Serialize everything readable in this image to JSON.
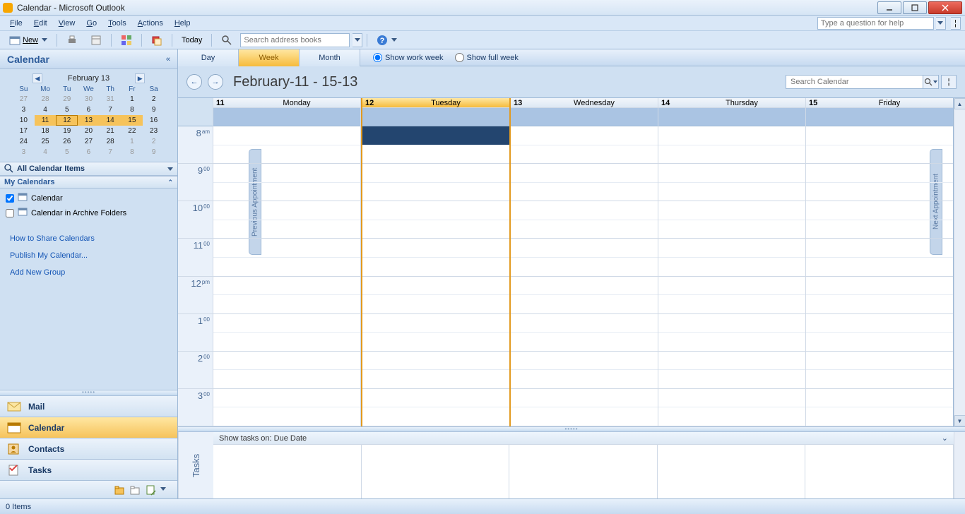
{
  "window": {
    "title": "Calendar - Microsoft Outlook"
  },
  "menu": {
    "items": [
      "File",
      "Edit",
      "View",
      "Go",
      "Tools",
      "Actions",
      "Help"
    ],
    "help_placeholder": "Type a question for help"
  },
  "toolbar": {
    "new_label": "New",
    "today_label": "Today",
    "address_placeholder": "Search address books"
  },
  "leftnav": {
    "title": "Calendar",
    "minical": {
      "label": "February 13",
      "dow": [
        "Su",
        "Mo",
        "Tu",
        "We",
        "Th",
        "Fr",
        "Sa"
      ],
      "rows": [
        [
          {
            "d": "27",
            "o": true
          },
          {
            "d": "28",
            "o": true
          },
          {
            "d": "29",
            "o": true
          },
          {
            "d": "30",
            "o": true
          },
          {
            "d": "31",
            "o": true
          },
          {
            "d": "1"
          },
          {
            "d": "2"
          }
        ],
        [
          {
            "d": "3"
          },
          {
            "d": "4"
          },
          {
            "d": "5"
          },
          {
            "d": "6"
          },
          {
            "d": "7"
          },
          {
            "d": "8"
          },
          {
            "d": "9"
          }
        ],
        [
          {
            "d": "10"
          },
          {
            "d": "11",
            "hl": true
          },
          {
            "d": "12",
            "today": true
          },
          {
            "d": "13",
            "hl": true
          },
          {
            "d": "14",
            "hl": true
          },
          {
            "d": "15",
            "hl": true
          },
          {
            "d": "16"
          }
        ],
        [
          {
            "d": "17"
          },
          {
            "d": "18"
          },
          {
            "d": "19"
          },
          {
            "d": "20"
          },
          {
            "d": "21"
          },
          {
            "d": "22"
          },
          {
            "d": "23"
          }
        ],
        [
          {
            "d": "24"
          },
          {
            "d": "25"
          },
          {
            "d": "26"
          },
          {
            "d": "27"
          },
          {
            "d": "28"
          },
          {
            "d": "1",
            "o": true
          },
          {
            "d": "2",
            "o": true
          }
        ],
        [
          {
            "d": "3",
            "o": true
          },
          {
            "d": "4",
            "o": true
          },
          {
            "d": "5",
            "o": true
          },
          {
            "d": "6",
            "o": true
          },
          {
            "d": "7",
            "o": true
          },
          {
            "d": "8",
            "o": true
          },
          {
            "d": "9",
            "o": true
          }
        ]
      ]
    },
    "all_items": "All Calendar Items",
    "my_calendars": "My Calendars",
    "cal1": "Calendar",
    "cal2": "Calendar in Archive Folders",
    "links": [
      "How to Share Calendars",
      "Publish My Calendar...",
      "Add New Group"
    ],
    "nav": {
      "mail": "Mail",
      "calendar": "Calendar",
      "contacts": "Contacts",
      "tasks": "Tasks"
    }
  },
  "view": {
    "tabs": [
      "Day",
      "Week",
      "Month"
    ],
    "active": "Week",
    "radio1": "Show work week",
    "radio2": "Show full week"
  },
  "header": {
    "range": "February-11 - 15-13",
    "search_placeholder": "Search Calendar"
  },
  "days": [
    {
      "num": "11",
      "name": "Monday"
    },
    {
      "num": "12",
      "name": "Tuesday",
      "today": true
    },
    {
      "num": "13",
      "name": "Wednesday"
    },
    {
      "num": "14",
      "name": "Thursday"
    },
    {
      "num": "15",
      "name": "Friday"
    }
  ],
  "hours": [
    {
      "h": "8",
      "m": "am"
    },
    {
      "h": "9",
      "m": "00"
    },
    {
      "h": "10",
      "m": "00"
    },
    {
      "h": "11",
      "m": "00"
    },
    {
      "h": "12",
      "m": "pm"
    },
    {
      "h": "1",
      "m": "00"
    },
    {
      "h": "2",
      "m": "00"
    },
    {
      "h": "3",
      "m": "00"
    }
  ],
  "sidetabs": {
    "prev": "Previous Appointment",
    "next": "Next Appointment"
  },
  "tasks": {
    "label": "Tasks",
    "header": "Show tasks on: Due Date"
  },
  "status": {
    "items": "0 Items"
  }
}
